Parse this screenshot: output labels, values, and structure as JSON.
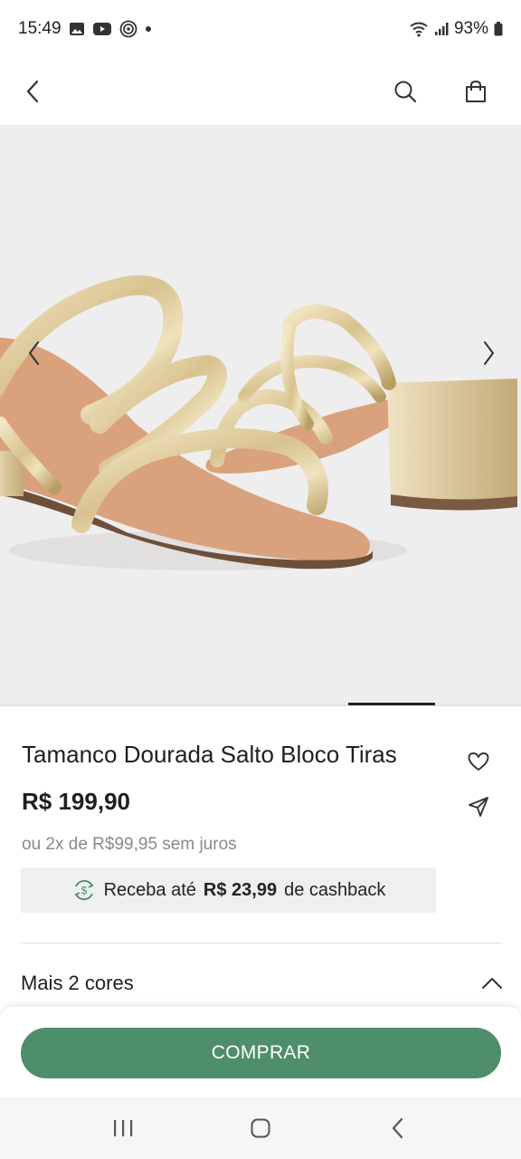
{
  "status_bar": {
    "time": "15:49",
    "notification_icons": [
      "image-icon",
      "youtube-icon",
      "podcast-icon",
      "dot-icon"
    ],
    "battery": "93%"
  },
  "header": {
    "back_icon": "chevron-left-icon",
    "search_icon": "search-icon",
    "bag_icon": "shopping-bag-icon"
  },
  "gallery": {
    "prev_icon": "chevron-left-icon",
    "next_icon": "chevron-right-icon",
    "current_slide_fraction": 0.83
  },
  "product": {
    "title": "Tamanco Dourada Salto Bloco Tiras",
    "price": "R$ 199,90",
    "installments": "ou 2x de R$99,95 sem juros",
    "favorite_icon": "heart-icon",
    "share_icon": "send-icon"
  },
  "cashback": {
    "prefix": "Receba até",
    "amount": "R$ 23,99",
    "suffix": "de cashback",
    "icon": "cashback-icon"
  },
  "colors": {
    "label": "Mais 2 cores",
    "icon": "chevron-up-icon"
  },
  "buy": {
    "label": "COMPRAR",
    "color": "#4f8e6a"
  },
  "nav_bar": {
    "icons": [
      "recents-icon",
      "home-icon",
      "back-icon"
    ]
  }
}
